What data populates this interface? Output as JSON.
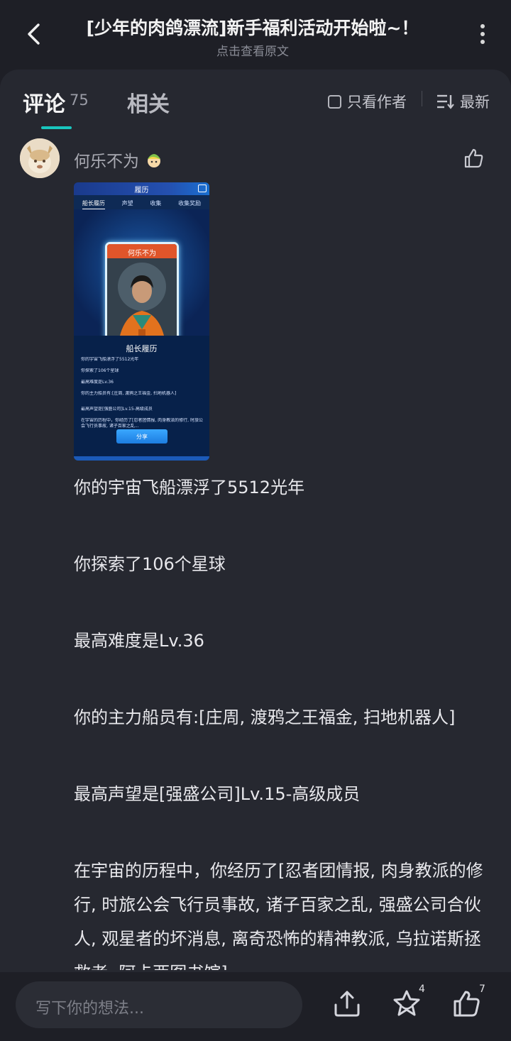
{
  "header": {
    "title": "[少年的肉鸽漂流]新手福利活动开始啦~！",
    "subtitle": "点击查看原文"
  },
  "tabs": {
    "comments_label": "评论",
    "comments_count": "75",
    "related_label": "相关",
    "author_only_label": "只看作者",
    "sort_label": "最新"
  },
  "comment": {
    "username": "何乐不为",
    "screenshot": {
      "header_title": "履历",
      "tabs": [
        "船长履历",
        "声望",
        "收集",
        "收集奖励"
      ],
      "card_name": "何乐不为",
      "heading": "船长履历",
      "lines": [
        "你的宇宙飞船漂浮了5512光年",
        "你探索了106个星球",
        "最高难度是Lv.36",
        "你的主力船员有:[庄周, 渡鸦之王福金, 扫地机器人]",
        "最高声望是[强盛公司]Lv.15-高级成员",
        "在宇宙的历程中，你经历了[忍者团情报, 肉身教派的修行, 时旅公会飞行员事故, 诸子百家之乱..."
      ],
      "share_label": "分享"
    },
    "paragraphs": [
      "你的宇宙飞船漂浮了5512光年",
      "你探索了106个星球",
      "最高难度是Lv.36",
      "你的主力船员有:[庄周, 渡鸦之王福金, 扫地机器人]",
      "最高声望是[强盛公司]Lv.15-高级成员",
      "在宇宙的历程中，你经历了[忍者团情报, 肉身教派的修行, 时旅公会飞行员事故, 诸子百家之乱, 强盛公司合伙人, 观星者的坏消息, 离奇恐怖的精神教派, 乌拉诺斯拯救者, 阿卡西图书馆]"
    ]
  },
  "bottom": {
    "input_placeholder": "写下你的想法...",
    "favorite_count": "4",
    "like_count": "7"
  },
  "colors": {
    "background": "#1e1f26",
    "panel": "#262830",
    "accent": "#19c6be"
  }
}
